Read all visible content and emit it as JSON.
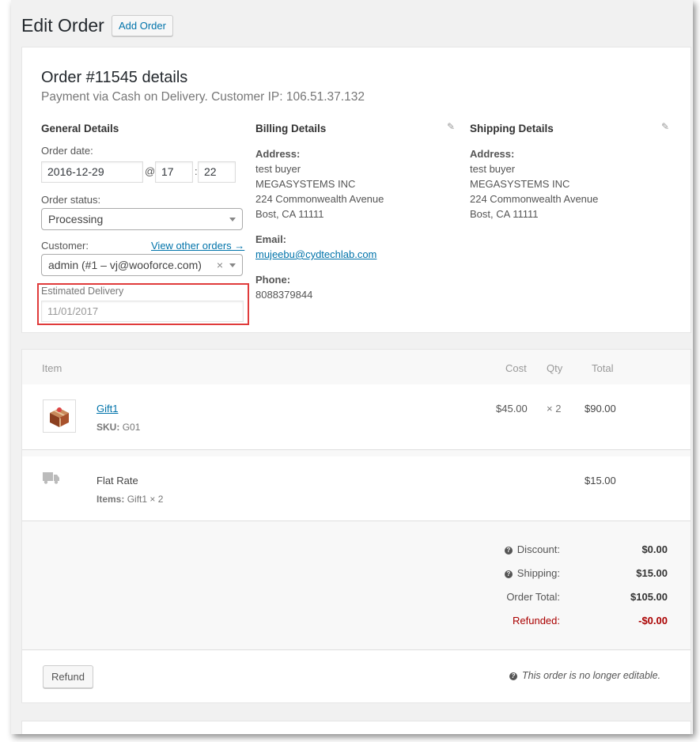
{
  "header": {
    "title": "Edit Order",
    "add_order": "Add Order"
  },
  "order": {
    "heading": "Order #11545 details",
    "subtitle": "Payment via Cash on Delivery. Customer IP: 106.51.37.132"
  },
  "general": {
    "title": "General Details",
    "order_date_label": "Order date:",
    "date": "2016-12-29",
    "at": "@",
    "hour": "17",
    "colon": ":",
    "minute": "22",
    "status_label": "Order status:",
    "status": "Processing",
    "customer_label": "Customer:",
    "view_other": "View other orders →",
    "customer": "admin (#1 – vj@wooforce.com)",
    "clear": "×",
    "est_label": "Estimated Delivery",
    "est_value": "11/01/2017"
  },
  "billing": {
    "title": "Billing Details",
    "address_label": "Address:",
    "address_lines": [
      "test buyer",
      "MEGASYSTEMS INC",
      "224 Commonwealth Avenue",
      "Bost, CA 11111"
    ],
    "email_label": "Email:",
    "email": "mujeebu@cydtechlab.com",
    "phone_label": "Phone:",
    "phone": "8088379844"
  },
  "shipping": {
    "title": "Shipping Details",
    "address_label": "Address:",
    "address_lines": [
      "test buyer",
      "MEGASYSTEMS INC",
      "224 Commonwealth Avenue",
      "Bost, CA 11111"
    ]
  },
  "items": {
    "headers": {
      "item": "Item",
      "cost": "Cost",
      "qty": "Qty",
      "total": "Total"
    },
    "product": {
      "name": "Gift1",
      "sku_label": "SKU:",
      "sku": "G01",
      "cost": "$45.00",
      "qty": "× 2",
      "total": "$90.00"
    },
    "shipping_line": {
      "name": "Flat Rate",
      "items_label": "Items:",
      "items": "Gift1 × 2",
      "total": "$15.00"
    }
  },
  "totals": {
    "discount_label": "Discount:",
    "discount": "$0.00",
    "shipping_label": "Shipping:",
    "shipping": "$15.00",
    "order_total_label": "Order Total:",
    "order_total": "$105.00",
    "refunded_label": "Refunded:",
    "refunded": "-$0.00",
    "refunded_color": "#a00"
  },
  "footer": {
    "refund": "Refund",
    "note": "This order is no longer editable."
  }
}
